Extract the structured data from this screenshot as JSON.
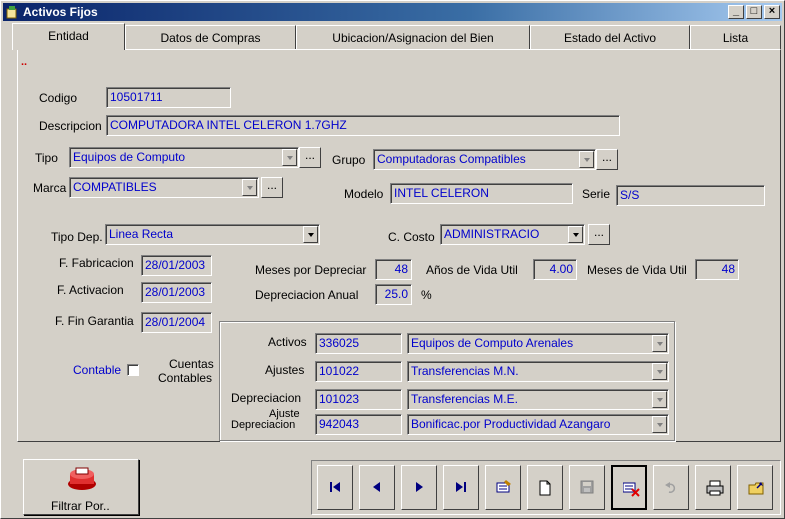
{
  "window": {
    "title": "Activos Fijos",
    "min": "_",
    "max": "□",
    "close": "×"
  },
  "tabs": [
    "Entidad",
    "Datos de Compras",
    "Ubicacion/Asignacion del Bien",
    "Estado del Activo",
    "Lista"
  ],
  "marker": "..",
  "form": {
    "codigo_label": "Codigo",
    "codigo": "10501711",
    "descripcion_label": "Descripcion",
    "descripcion": "COMPUTADORA INTEL CELERON 1.7GHZ",
    "tipo_label": "Tipo",
    "tipo": "Equipos de Computo",
    "grupo_label": "Grupo",
    "grupo": "Computadoras Compatibles",
    "marca_label": "Marca",
    "marca": "COMPATIBLES",
    "modelo_label": "Modelo",
    "modelo": "INTEL CELERON",
    "serie_label": "Serie",
    "serie": "S/S",
    "tipo_dep_label": "Tipo Dep.",
    "tipo_dep": "Linea Recta",
    "c_costo_label": "C. Costo",
    "c_costo": "ADMINISTRACIO",
    "f_fabricacion_label": "F. Fabricacion",
    "f_fabricacion": "28/01/2003",
    "f_activacion_label": "F. Activacion",
    "f_activacion": "28/01/2003",
    "f_fin_garantia_label": "F. Fin Garantia",
    "f_fin_garantia": "28/01/2004",
    "meses_por_depreciar_label": "Meses por Depreciar",
    "meses_por_depreciar": "48",
    "anos_vida_util_label": "Años de Vida Util",
    "anos_vida_util": "4.00",
    "meses_vida_util_label": "Meses de Vida Util",
    "meses_vida_util": "48",
    "depreciacion_anual_label": "Depreciacion Anual",
    "depreciacion_anual": "25.0",
    "percent": "%",
    "contable_label": "Contable",
    "cuentas_label_1": "Cuentas",
    "cuentas_label_2": "Contables"
  },
  "cuentas": [
    {
      "label": "Activos",
      "code": "336025",
      "name": "Equipos de Computo Arenales"
    },
    {
      "label": "Ajustes",
      "code": "101022",
      "name": "Transferencias M.N."
    },
    {
      "label": "Depreciacion",
      "code": "101023",
      "name": "Transferencias  M.E."
    },
    {
      "label_1": "Ajuste",
      "label_2": "Depreciacion",
      "code": "942043",
      "name": "Bonificac.por Productividad Azangaro"
    }
  ],
  "buttons": {
    "filtrar": "Filtrar Por..",
    "dots": "..."
  },
  "icons": [
    "first-record-icon",
    "previous-record-icon",
    "next-record-icon",
    "last-record-icon",
    "edit-icon",
    "new-document-icon",
    "save-icon",
    "delete-icon",
    "undo-icon",
    "print-icon",
    "exit-icon"
  ]
}
